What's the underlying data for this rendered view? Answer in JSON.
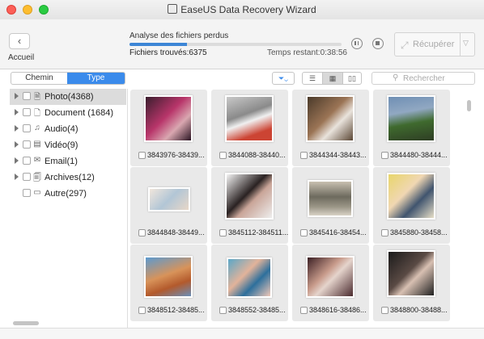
{
  "window": {
    "title": "EaseUS Data Recovery Wizard"
  },
  "toolbar": {
    "home_label": "Accueil",
    "status_title": "Analyse des fichiers perdus",
    "progress_fraction": 0.27,
    "files_found": "Fichiers trouvés:6375",
    "time_remaining": "Temps restant:0:38:56",
    "recover_label": "Récupérer"
  },
  "tabs": [
    {
      "label": "Chemin"
    },
    {
      "label": "Type"
    }
  ],
  "search": {
    "placeholder": "Rechercher"
  },
  "sidebar": {
    "items": [
      {
        "label": "Photo(4368)",
        "icon": "photo-file-icon"
      },
      {
        "label": "Document (1684)",
        "icon": "document-icon"
      },
      {
        "label": "Audio(4)",
        "icon": "music-note-icon"
      },
      {
        "label": "Vidéo(9)",
        "icon": "film-icon"
      },
      {
        "label": "Email(1)",
        "icon": "envelope-icon"
      },
      {
        "label": "Archives(12)",
        "icon": "archive-icon"
      },
      {
        "label": "Autre(297)",
        "icon": "folder-icon"
      }
    ]
  },
  "files": [
    {
      "name": "3843976-38439..."
    },
    {
      "name": "3844088-38440..."
    },
    {
      "name": "3844344-38443..."
    },
    {
      "name": "3844480-38444..."
    },
    {
      "name": "3844848-38449..."
    },
    {
      "name": "3845112-384511..."
    },
    {
      "name": "3845416-38454..."
    },
    {
      "name": "3845880-38458..."
    },
    {
      "name": "3848512-38485..."
    },
    {
      "name": "3848552-38485..."
    },
    {
      "name": "3848616-38486..."
    },
    {
      "name": "3848800-38488..."
    }
  ],
  "colors": {
    "accent": "#3b8beb",
    "progress": "#3d86d6"
  }
}
